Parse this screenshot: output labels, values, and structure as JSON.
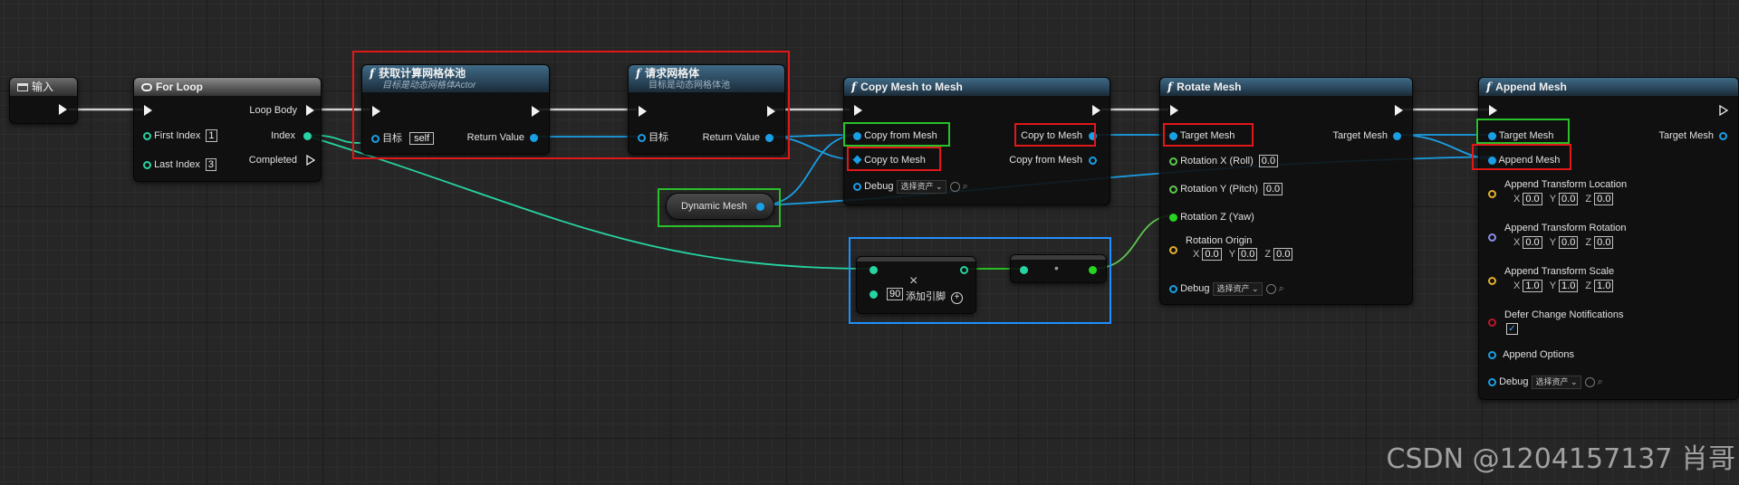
{
  "nodes": {
    "input": {
      "title": "输入"
    },
    "for_loop": {
      "title": "For Loop",
      "loop_body": "Loop Body",
      "index": "Index",
      "completed": "Completed",
      "first_index_label": "First Index",
      "first_index_value": "1",
      "last_index_label": "Last Index",
      "last_index_value": "3"
    },
    "get_compute_pool": {
      "title": "获取计算网格体池",
      "subtitle": "目标是动态网格体Actor",
      "target_label": "目标",
      "target_value": "self",
      "return_value": "Return Value"
    },
    "request_mesh": {
      "title": "请求网格体",
      "subtitle": "目标是动态网格体池",
      "target_label": "目标",
      "return_value": "Return Value"
    },
    "copy_mesh_to_mesh": {
      "title": "Copy Mesh to Mesh",
      "copy_from_mesh": "Copy from Mesh",
      "copy_to_mesh_in": "Copy to Mesh",
      "copy_to_mesh_out": "Copy to Mesh",
      "copy_from_mesh_out": "Copy from Mesh",
      "debug_label": "Debug",
      "debug_select": "选择资产"
    },
    "dynamic_mesh": {
      "label": "Dynamic Mesh"
    },
    "multiply": {
      "value": "90",
      "add_pin": "添加引脚",
      "symbol": "×"
    },
    "convert": {
      "symbol": "•"
    },
    "rotate_mesh": {
      "title": "Rotate Mesh",
      "target_mesh_in": "Target Mesh",
      "target_mesh_out": "Target Mesh",
      "rotation_x": "Rotation X (Roll)",
      "rotation_x_value": "0.0",
      "rotation_y": "Rotation Y (Pitch)",
      "rotation_y_value": "0.0",
      "rotation_z": "Rotation Z (Yaw)",
      "rotation_origin": "Rotation Origin",
      "origin_x": "0.0",
      "origin_y": "0.0",
      "origin_z": "0.0",
      "debug_label": "Debug",
      "debug_select": "选择资产"
    },
    "append_mesh": {
      "title": "Append Mesh",
      "target_mesh_in": "Target Mesh",
      "target_mesh_out": "Target Mesh",
      "append_mesh": "Append Mesh",
      "location_label": "Append Transform Location",
      "loc_x": "0.0",
      "loc_y": "0.0",
      "loc_z": "0.0",
      "rotation_label": "Append Transform Rotation",
      "rot_x": "0.0",
      "rot_y": "0.0",
      "rot_z": "0.0",
      "scale_label": "Append Transform Scale",
      "scale_x": "1.0",
      "scale_y": "1.0",
      "scale_z": "1.0",
      "defer_label": "Defer Change Notifications",
      "options_label": "Append Options",
      "debug_label": "Debug",
      "debug_select": "选择资产"
    }
  },
  "axis_labels": {
    "x": "X",
    "y": "Y",
    "z": "Z"
  },
  "watermark": "CSDN @1204157137 肖哥",
  "colors": {
    "exec": "#f2f2f2",
    "object_pin": "#1a9fe6",
    "int_pin": "#26d4a2",
    "float_pin": "#27d420",
    "vector_pin": "#e5b02b",
    "highlight_red": "#e01818",
    "highlight_green": "#2ac02a",
    "highlight_blue": "#1e90ff"
  }
}
